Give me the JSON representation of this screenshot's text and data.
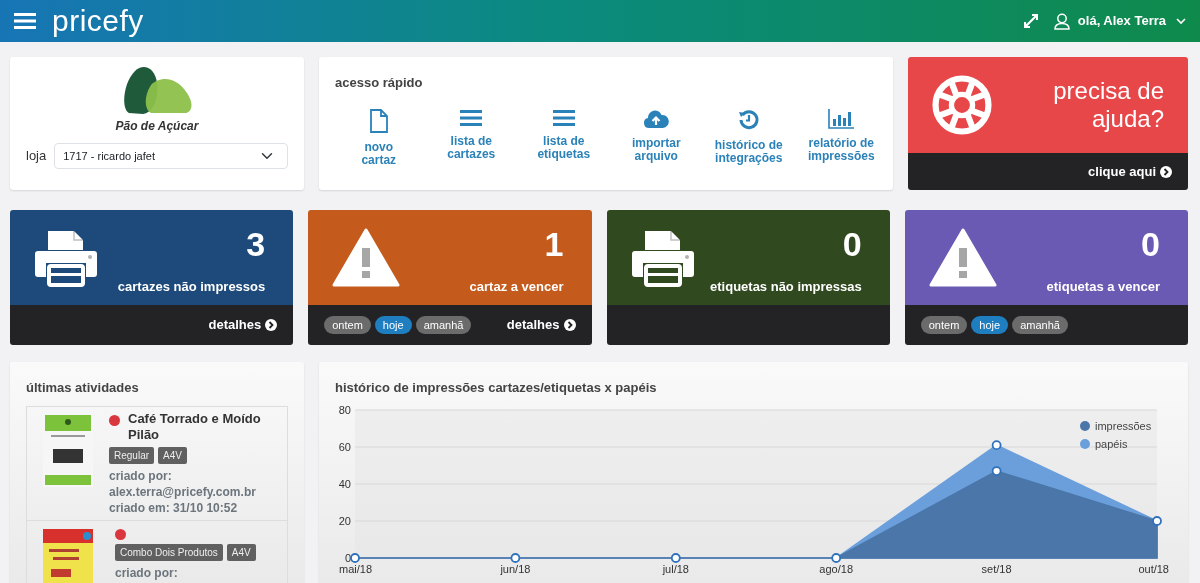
{
  "header": {
    "brand": "pricefy",
    "user_greeting": "olá, Alex Terra"
  },
  "store": {
    "brand": "Pão de Açúcar",
    "label": "loja",
    "value": "1717 - ricardo jafet"
  },
  "quick_access": {
    "title": "acesso rápido",
    "items": [
      {
        "kind": "file",
        "label": "novo\ncartaz"
      },
      {
        "kind": "list",
        "label": "lista de\ncartazes"
      },
      {
        "kind": "list",
        "label": "lista de\netiquetas"
      },
      {
        "kind": "upload",
        "label": "importar\narquivo"
      },
      {
        "kind": "history",
        "label": "histórico de\nintegrações"
      },
      {
        "kind": "chart",
        "label": "relatório de\nimpressões"
      }
    ]
  },
  "help": {
    "title": "precisa de\najuda?",
    "link": "clique aqui"
  },
  "stats": [
    {
      "kind": "printer",
      "color": "#1d4a7a",
      "count": "3",
      "label": "cartazes não impressos",
      "link": "detalhes"
    },
    {
      "kind": "warning",
      "color": "#c45a1c",
      "count": "1",
      "label": "cartaz a vencer",
      "link": "detalhes",
      "filters": [
        {
          "label": "ontem",
          "selected": false
        },
        {
          "label": "hoje",
          "selected": true
        },
        {
          "label": "amanhã",
          "selected": false
        }
      ]
    },
    {
      "kind": "printer",
      "color": "#30491f",
      "count": "0",
      "label": "etiquetas não impressas"
    },
    {
      "kind": "warning",
      "color": "#6a5ab3",
      "count": "0",
      "label": "etiquetas a vencer",
      "filters": [
        {
          "label": "ontem",
          "selected": false
        },
        {
          "label": "hoje",
          "selected": true
        },
        {
          "label": "amanhã",
          "selected": false
        }
      ]
    }
  ],
  "activities": {
    "title": "últimas atividades",
    "items": [
      {
        "color": "#d9363e",
        "title": "Café Torrado e Moído Pilão",
        "tags": [
          "Regular",
          "A4V"
        ],
        "created_by_label": "criado por:",
        "created_by": "alex.terra@pricefy.com.br",
        "created_at": "criado em: 31/10 10:52"
      },
      {
        "color": "#d9363e",
        "tags": [
          "Combo Dois Produtos",
          "A4V"
        ],
        "created_by_label": "criado por:"
      }
    ]
  },
  "history": {
    "title": "histórico de impressões cartazes/etiquetas x papéis",
    "chart_data": {
      "type": "area",
      "categories": [
        "mai/18",
        "jun/18",
        "jul/18",
        "ago/18",
        "set/18",
        "out/18"
      ],
      "series": [
        {
          "name": "impressões",
          "color": "#4b76a9",
          "values": [
            0,
            0,
            0,
            0,
            47,
            20
          ]
        },
        {
          "name": "papéis",
          "color": "#6a9fdc",
          "values": [
            0,
            0,
            0,
            0,
            61,
            20
          ]
        }
      ],
      "ylim": [
        0,
        80
      ],
      "yticks": [
        0,
        20,
        40,
        60,
        80
      ],
      "stacked": false,
      "grid": true,
      "legend": true
    }
  }
}
